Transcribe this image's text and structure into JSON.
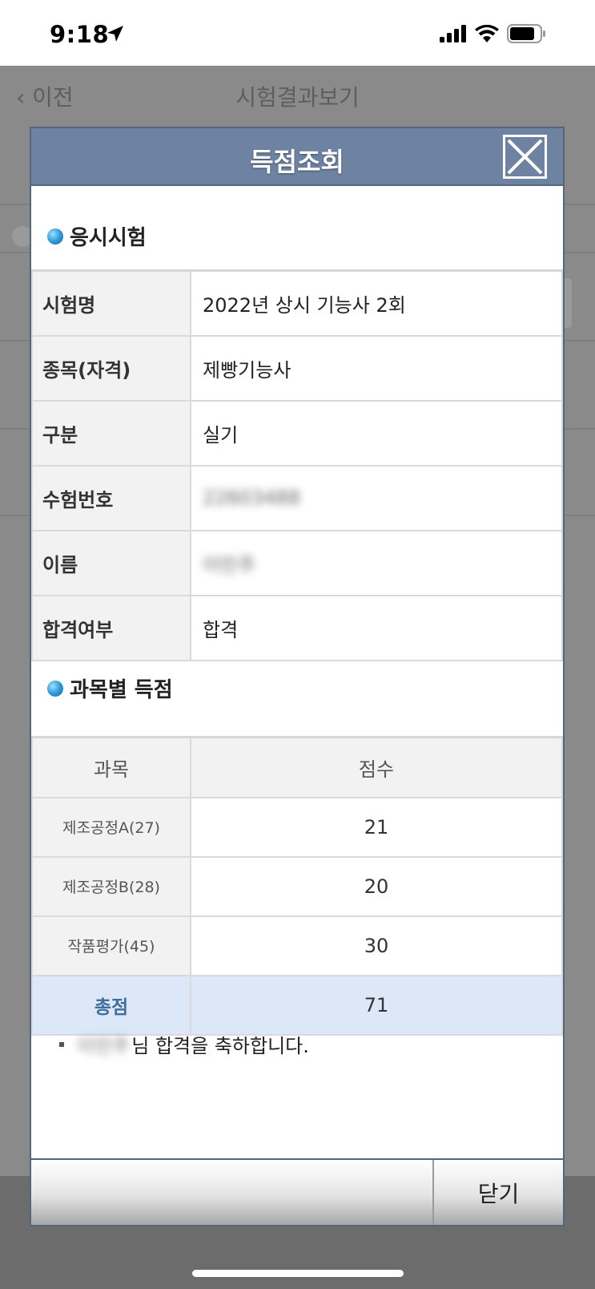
{
  "status_bar": {
    "time": "9:18"
  },
  "background": {
    "back_label": "이전",
    "title": "시험결과보기"
  },
  "modal": {
    "title": "득점조회",
    "section_exam": "응시시험",
    "info_rows": [
      {
        "label": "시험명",
        "value": "2022년 상시 기능사 2회"
      },
      {
        "label": "종목(자격)",
        "value": "제빵기능사"
      },
      {
        "label": "구분",
        "value": "실기"
      },
      {
        "label": "수험번호",
        "value": "22603488"
      },
      {
        "label": "이름",
        "value": "이민주"
      },
      {
        "label": "합격여부",
        "value": "합격"
      }
    ],
    "section_scores": "과목별 득점",
    "score_headers": {
      "subject": "과목",
      "score": "점수"
    },
    "scores": [
      {
        "subject": "제조공정A(27)",
        "score": "21"
      },
      {
        "subject": "제조공정B(28)",
        "score": "20"
      },
      {
        "subject": "작품평가(45)",
        "score": "30"
      }
    ],
    "total": {
      "label": "총점",
      "score": "71"
    },
    "congrats_name": "이민주",
    "congrats_text": "님 합격을 축하합니다.",
    "close_label": "닫기"
  }
}
